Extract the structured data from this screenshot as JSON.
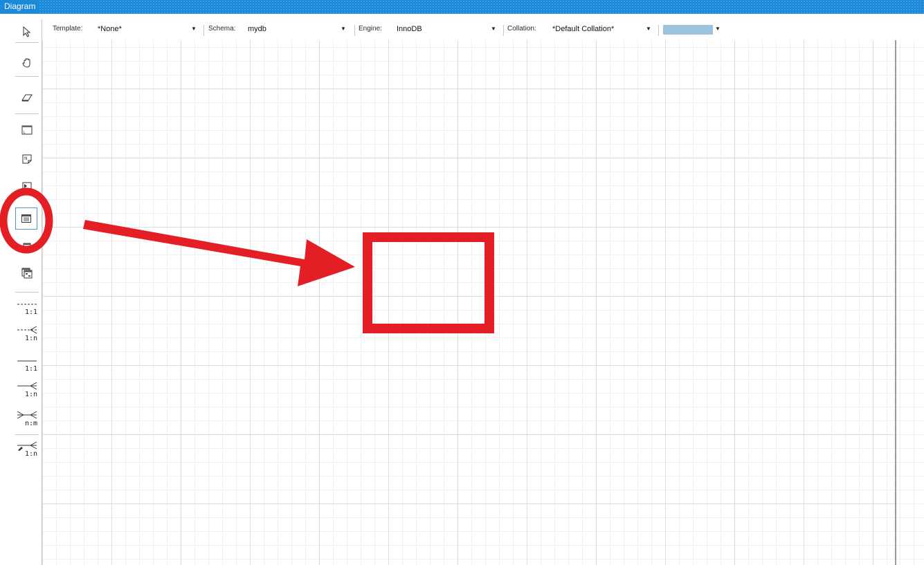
{
  "window": {
    "title": "Diagram"
  },
  "toolbox": {
    "tools": [
      {
        "name": "select-pointer-tool"
      },
      {
        "name": "hand-pan-tool"
      },
      {
        "name": "eraser-tool"
      },
      {
        "name": "layer-tool"
      },
      {
        "name": "text-note-tool"
      },
      {
        "name": "image-tool"
      },
      {
        "name": "new-table-tool",
        "selected": true
      },
      {
        "name": "new-view-tool"
      },
      {
        "name": "routine-group-tool"
      }
    ],
    "relationships": [
      {
        "label": "1:1",
        "style": "non-identifying-1-1"
      },
      {
        "label": "1:n",
        "style": "non-identifying-1-n"
      },
      {
        "label": "1:1",
        "style": "identifying-1-1"
      },
      {
        "label": "1:n",
        "style": "identifying-1-n"
      },
      {
        "label": "n:m",
        "style": "identifying-n-m"
      },
      {
        "label": "1:n",
        "style": "existing-columns-1-n"
      }
    ]
  },
  "options": {
    "template_label": "Template:",
    "template_value": "*None*",
    "schema_label": "Schema:",
    "schema_value": "mydb",
    "engine_label": "Engine:",
    "engine_value": "InnoDB",
    "collation_label": "Collation:",
    "collation_value": "*Default Collation*",
    "color_value": "#9cc2de"
  },
  "annotation": {
    "color": "#e31e24",
    "items": [
      "circle-highlight",
      "arrow",
      "target-rectangle"
    ]
  }
}
